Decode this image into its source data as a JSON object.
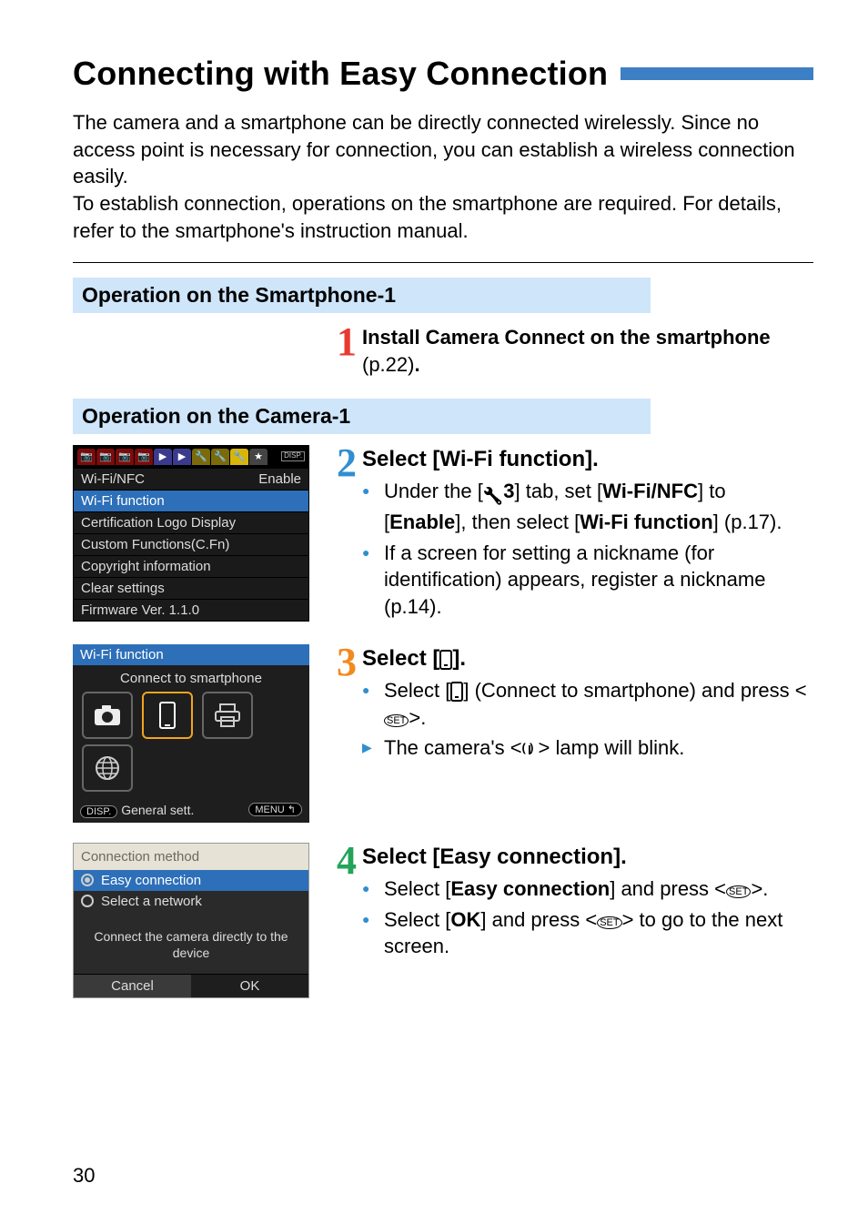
{
  "title": "Connecting with Easy Connection",
  "intro": "The camera and a smartphone can be directly connected wirelessly. Since no access point is necessary for connection, you can establish a wireless connection easily.\nTo establish connection, operations on the smartphone are required. For details, refer to the smartphone's instruction manual.",
  "sections": {
    "smartphone1": {
      "heading": "Operation on the Smartphone-1",
      "step1": {
        "title_a": "Install Camera Connect on the smartphone",
        "title_b": " (p.22)",
        "title_c": "."
      }
    },
    "camera1": {
      "heading": "Operation on the Camera-1",
      "step2": {
        "title": "Select [Wi-Fi function].",
        "b1_a": "Under the [",
        "b1_b": "3",
        "b1_c": "] tab, set [",
        "b1_d": "Wi-Fi/NFC",
        "b1_e": "] to [",
        "b1_f": "Enable",
        "b1_g": "], then select [",
        "b1_h": "Wi-Fi function",
        "b1_i": "] (p.17).",
        "b2": "If a screen for setting a nickname (for identification) appears, register a nickname (p.14)."
      },
      "step3": {
        "title_a": "Select [",
        "title_b": "].",
        "b1_a": "Select [",
        "b1_b": "] (Connect to smartphone) and press <",
        "b1_c": ">.",
        "b2_a": "The camera's <",
        "b2_b": "> lamp will blink."
      },
      "step4": {
        "title": "Select [Easy connection].",
        "b1_a": "Select [",
        "b1_b": "Easy connection",
        "b1_c": "] and press <",
        "b1_d": ">.",
        "b2_a": "Select [",
        "b2_b": "OK",
        "b2_c": "] and press <",
        "b2_d": "> to go to the next screen."
      }
    }
  },
  "cam_screens": {
    "s1": {
      "rows": [
        {
          "l": "Wi-Fi/NFC",
          "r": "Enable"
        },
        {
          "l": "Wi-Fi function",
          "r": ""
        },
        {
          "l": "Certification Logo Display",
          "r": ""
        },
        {
          "l": "Custom Functions(C.Fn)",
          "r": ""
        },
        {
          "l": "Copyright information",
          "r": ""
        },
        {
          "l": "Clear settings",
          "r": ""
        },
        {
          "l": "Firmware Ver. 1.1.0",
          "r": ""
        }
      ],
      "disp": "DISP."
    },
    "s2": {
      "title": "Wi-Fi function",
      "subtitle": "Connect to smartphone",
      "footer_l": "General sett.",
      "footer_disp": "DISP.",
      "footer_r": "MENU ↰"
    },
    "s3": {
      "title": "Connection method",
      "opt1": "Easy connection",
      "opt2": "Select a network",
      "msg": "Connect the camera directly to the device",
      "btn_cancel": "Cancel",
      "btn_ok": "OK"
    }
  },
  "glyphs": {
    "set": "SET"
  },
  "page_num": "30"
}
